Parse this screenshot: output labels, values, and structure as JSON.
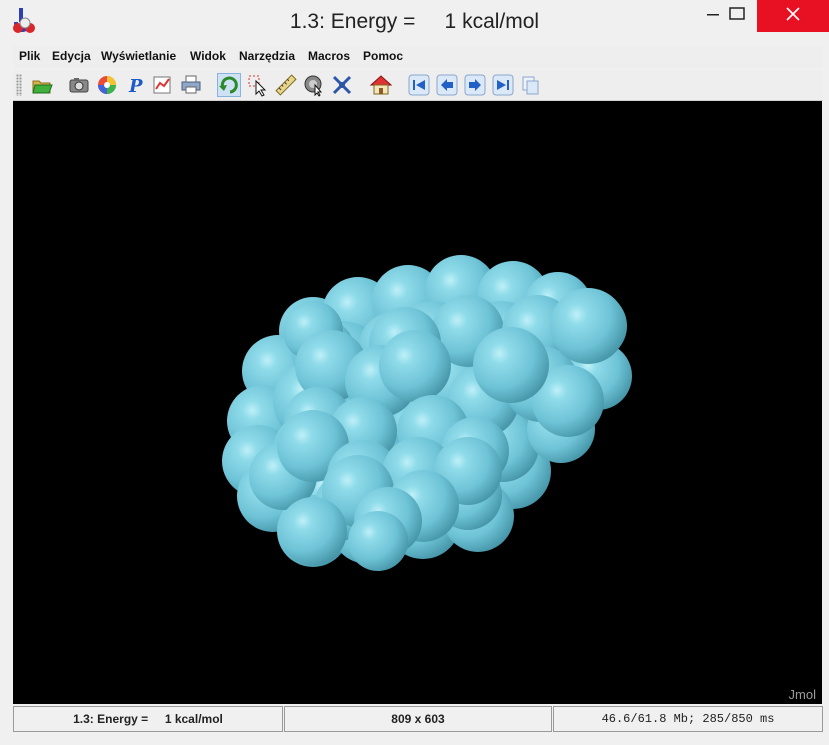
{
  "window": {
    "title": "1.3: Energy =     1 kcal/mol",
    "icon": "jmol-app-icon",
    "controls": [
      "minimize-icon",
      "maximize-icon",
      "close-icon"
    ],
    "close_color": "#e81123"
  },
  "menu": {
    "items": [
      {
        "label": "Plik"
      },
      {
        "label": "Edycja"
      },
      {
        "label": "Wyświetlanie"
      },
      {
        "label": "Widok"
      },
      {
        "label": "Narzędzia"
      },
      {
        "label": "Macros"
      },
      {
        "label": "Pomoc"
      }
    ]
  },
  "toolbar": {
    "buttons": [
      {
        "name": "open-folder-icon"
      },
      {
        "name": "camera-icon"
      },
      {
        "name": "color-wheel-icon"
      },
      {
        "name": "help-pointer-icon"
      },
      {
        "name": "edit-chart-icon"
      },
      {
        "name": "print-icon"
      },
      {
        "name": "rotate-icon",
        "active": true
      },
      {
        "name": "select-pointer-icon"
      },
      {
        "name": "measure-ruler-icon"
      },
      {
        "name": "spin-pointer-icon"
      },
      {
        "name": "pick-center-icon"
      },
      {
        "name": "home-icon"
      },
      {
        "name": "first-frame-icon"
      },
      {
        "name": "previous-frame-icon"
      },
      {
        "name": "next-frame-icon"
      },
      {
        "name": "last-frame-icon"
      },
      {
        "name": "copy-frames-icon"
      }
    ]
  },
  "viewer": {
    "background": "#000000",
    "atom_color": "#6fc6d8",
    "watermark": "Jmol"
  },
  "status": {
    "energy": "1.3: Energy =     1 kcal/mol",
    "dimensions": "809 x 603",
    "memory": "46.6/61.8 Mb; 285/850 ms"
  }
}
